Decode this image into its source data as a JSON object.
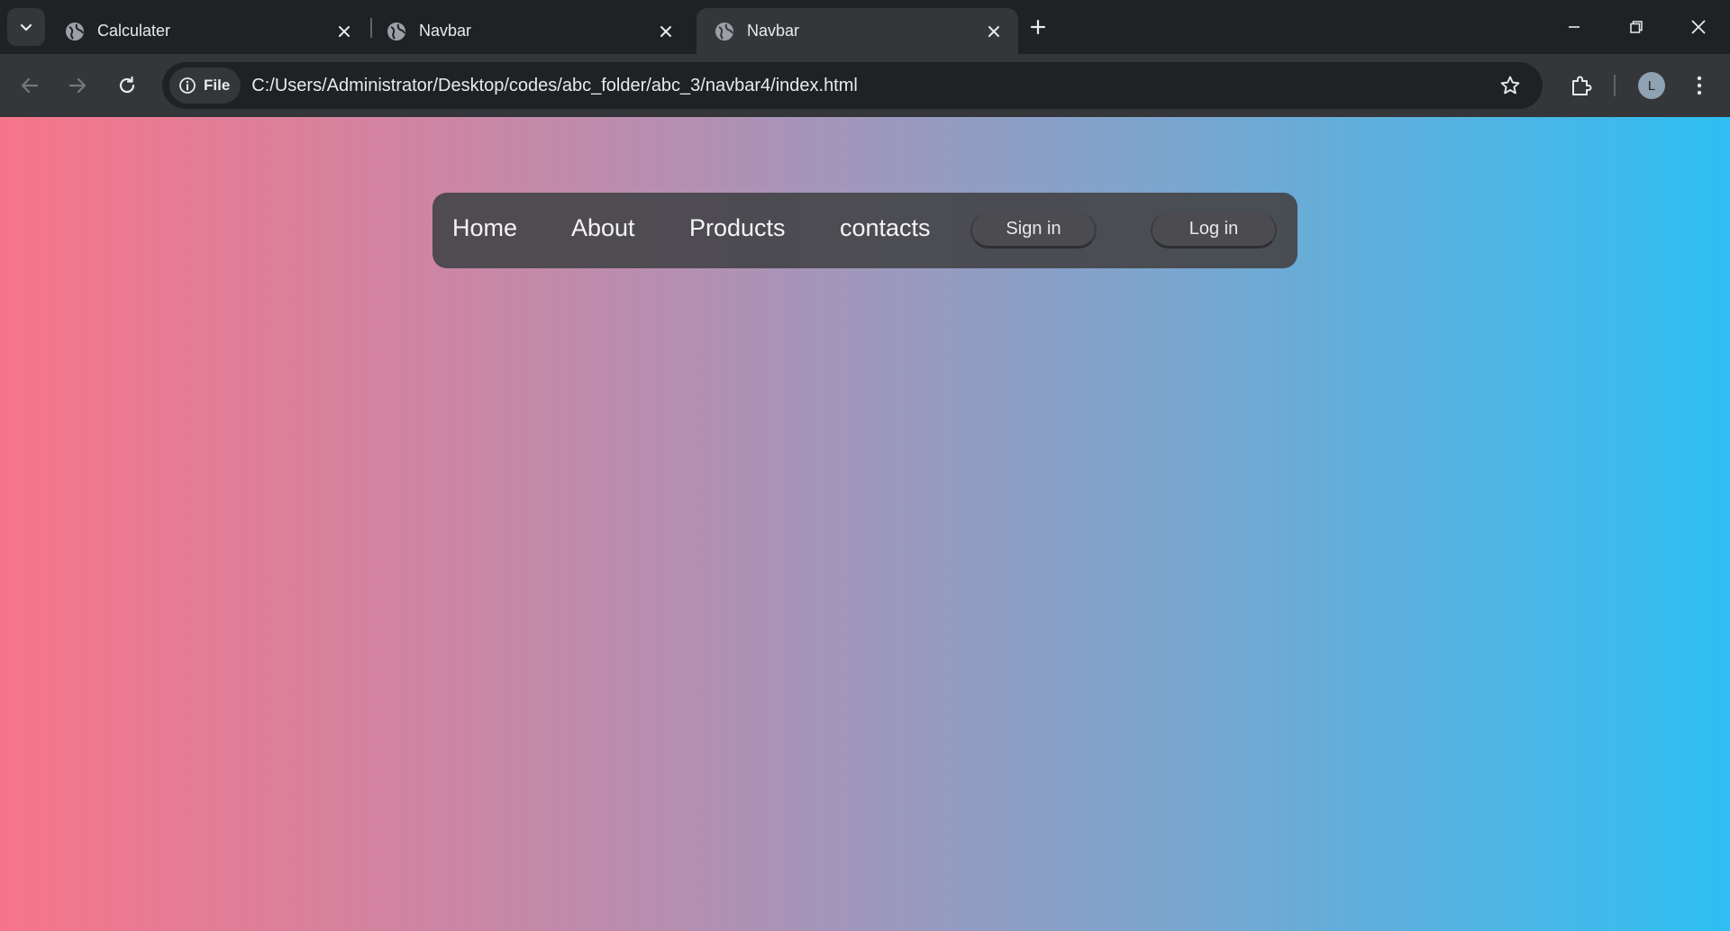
{
  "tabs": [
    {
      "title": "Calculater",
      "active": false
    },
    {
      "title": "Navbar",
      "active": false
    },
    {
      "title": "Navbar",
      "active": true
    }
  ],
  "toolbar": {
    "security_chip_label": "File",
    "url": "C:/Users/Administrator/Desktop/codes/abc_folder/abc_3/navbar4/index.html",
    "profile_initial": "L"
  },
  "page": {
    "nav_links": [
      "Home",
      "About",
      "Products",
      "contacts"
    ],
    "sign_in_label": "Sign in",
    "log_in_label": "Log in"
  },
  "icons": {
    "tab_search": "chevron-down-icon",
    "favicon": "globe-icon",
    "close": "close-icon",
    "new_tab": "plus-icon",
    "back": "arrow-left-icon",
    "forward": "arrow-right-icon",
    "reload": "reload-icon",
    "info": "info-icon",
    "bookmark": "star-icon",
    "extensions": "puzzle-icon",
    "menu": "kebab-menu-icon"
  },
  "colors": {
    "gradient_start": "#f7758a",
    "gradient_end": "#2ebff3",
    "navbar_bg": "#46464a"
  }
}
